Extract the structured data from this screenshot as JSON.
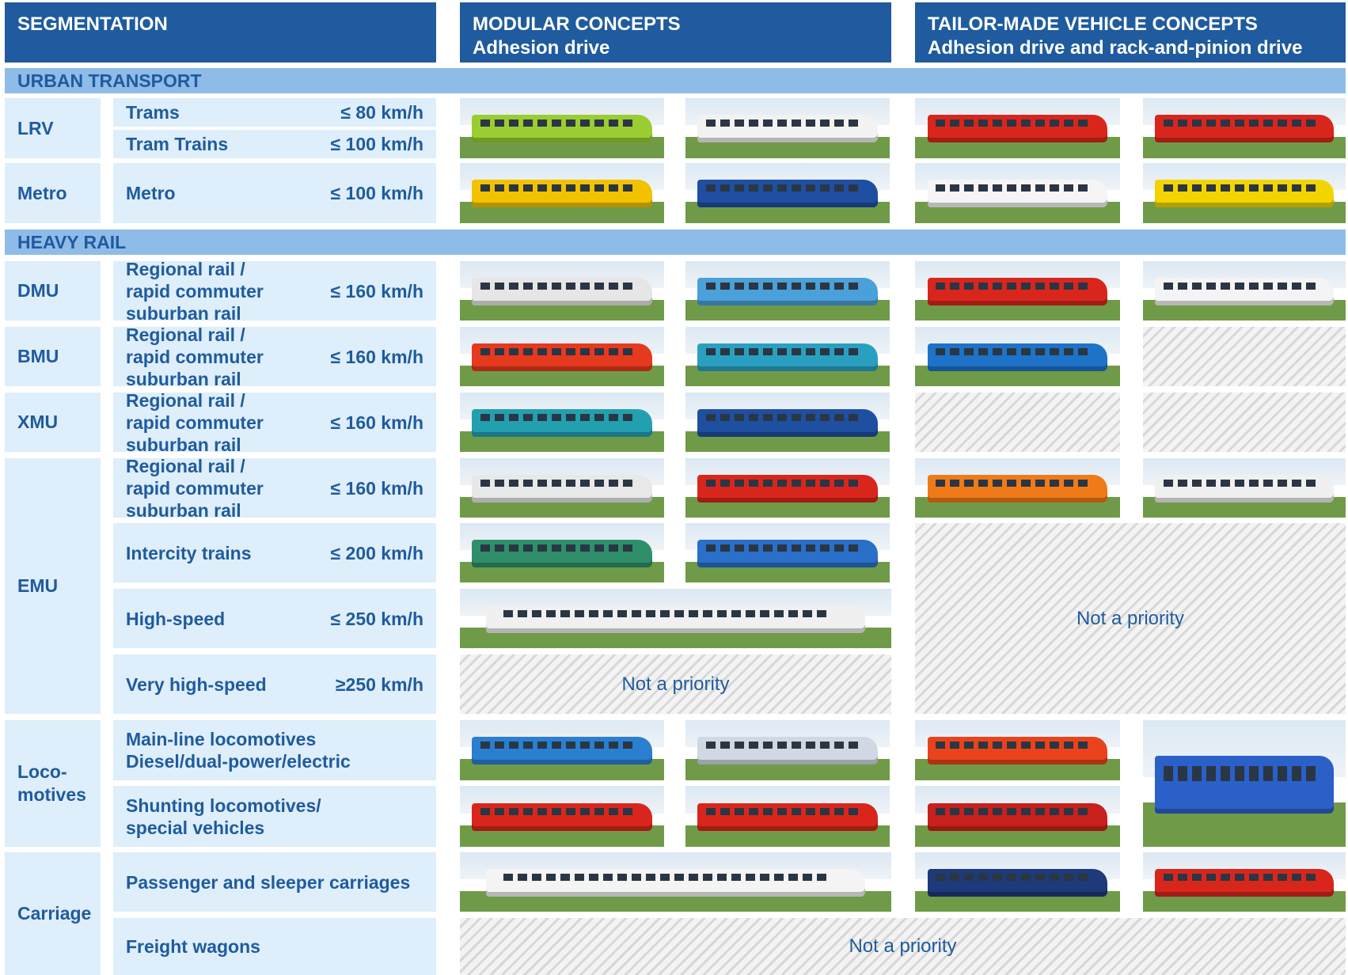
{
  "header": {
    "segmentation": "SEGMENTATION",
    "modular_title": "MODULAR CONCEPTS",
    "modular_sub": "Adhesion drive",
    "tailor_title": "TAILOR-MADE VEHICLE CONCEPTS",
    "tailor_sub": "Adhesion drive and rack-and-pinion drive"
  },
  "bands": {
    "urban": "URBAN TRANSPORT",
    "heavy": "HEAVY RAIL"
  },
  "groups": {
    "lrv": "LRV",
    "metro": "Metro",
    "dmu": "DMU",
    "bmu": "BMU",
    "xmu": "XMU",
    "emu": "EMU",
    "loco_1": "Loco-",
    "loco_2": "motives",
    "carriage": "Carriage"
  },
  "rows": {
    "trams": {
      "label": "Trams",
      "speed": "≤ 80 km/h"
    },
    "tram_trains": {
      "label": "Tram Trains",
      "speed": "≤ 100 km/h"
    },
    "metro": {
      "label": "Metro",
      "speed": "≤ 100 km/h"
    },
    "regional_l1": "Regional rail /",
    "regional_l2": "rapid commuter",
    "regional_l3": "suburban rail",
    "regional_speed": "≤ 160 km/h",
    "intercity": {
      "label": "Intercity trains",
      "speed": "≤ 200 km/h"
    },
    "high_speed": {
      "label": "High-speed",
      "speed": "≤ 250 km/h"
    },
    "very_high_speed": {
      "label": "Very high-speed",
      "speed": "≥250 km/h"
    },
    "main_line_l1": "Main-line locomotives",
    "main_line_l2": "Diesel/dual-power/electric",
    "shunting_l1": "Shunting locomotives/",
    "shunting_l2": "special vehicles",
    "passenger": "Passenger and sleeper carriages",
    "freight": "Freight wagons"
  },
  "not_priority": "Not a priority",
  "colors": {
    "header_blue": "#1f5b9e",
    "band_blue": "#8fbbe8",
    "cell_blue": "#deeefa"
  }
}
